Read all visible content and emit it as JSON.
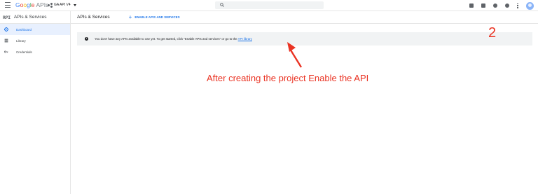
{
  "topbar": {
    "logo_letters": [
      "G",
      "o",
      "o",
      "g",
      "l",
      "e"
    ],
    "logo_suffix": "APIs",
    "project_name": "GA API V4",
    "search": {
      "placeholder": ""
    }
  },
  "sidebar": {
    "badge": "RPI",
    "title": "APIs & Services",
    "items": [
      {
        "label": "Dashboard",
        "icon": "dashboard-icon",
        "active": true
      },
      {
        "label": "Library",
        "icon": "library-icon",
        "active": false
      },
      {
        "label": "Credentials",
        "icon": "key-icon",
        "active": false
      }
    ]
  },
  "main": {
    "title": "APIs & Services",
    "enable_button": "ENABLE APIS AND SERVICES",
    "banner": {
      "text": "You don't have any APIs available to use yet. To get started, click \"Enable APIs and services\" or go to the",
      "link": "API library"
    }
  },
  "annotation": {
    "step": "2",
    "caption": "After creating the project Enable the API",
    "color": "#ea3323"
  },
  "colors": {
    "accent": "#1a73e8",
    "active_bg": "#e8f0fe",
    "banner_bg": "#f1f3f4"
  }
}
